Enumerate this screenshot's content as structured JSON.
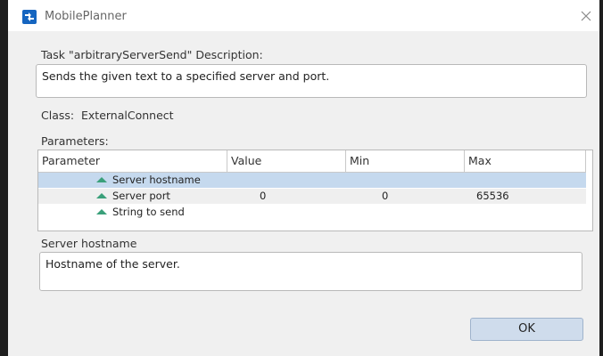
{
  "window": {
    "title": "MobilePlanner"
  },
  "task": {
    "description_label": "Task \"arbitraryServerSend\" Description:",
    "description": "Sends the given text to a specified server and port."
  },
  "class": {
    "label": "Class:",
    "value": "ExternalConnect"
  },
  "parameters": {
    "label": "Parameters:",
    "columns": [
      "Parameter",
      "Value",
      "Min",
      "Max"
    ],
    "rows": [
      {
        "name": "Server hostname",
        "value": "",
        "min": "",
        "max": "",
        "selected": true
      },
      {
        "name": "Server port",
        "value": "0",
        "min": "0",
        "max": "65536",
        "selected": false
      },
      {
        "name": "String to send",
        "value": "",
        "min": "",
        "max": "",
        "selected": false
      }
    ]
  },
  "detail": {
    "title": "Server hostname",
    "description": "Hostname of the server."
  },
  "buttons": {
    "ok_label": "OK"
  },
  "colors": {
    "accent": "#1565c0",
    "selected_row": "#c5d9ee",
    "param_icon": "#3aa07a",
    "ok_button": "#cfdcec"
  },
  "icons": {
    "app": "app-logo-icon",
    "close": "close-icon",
    "param": "triangle-up-icon"
  }
}
